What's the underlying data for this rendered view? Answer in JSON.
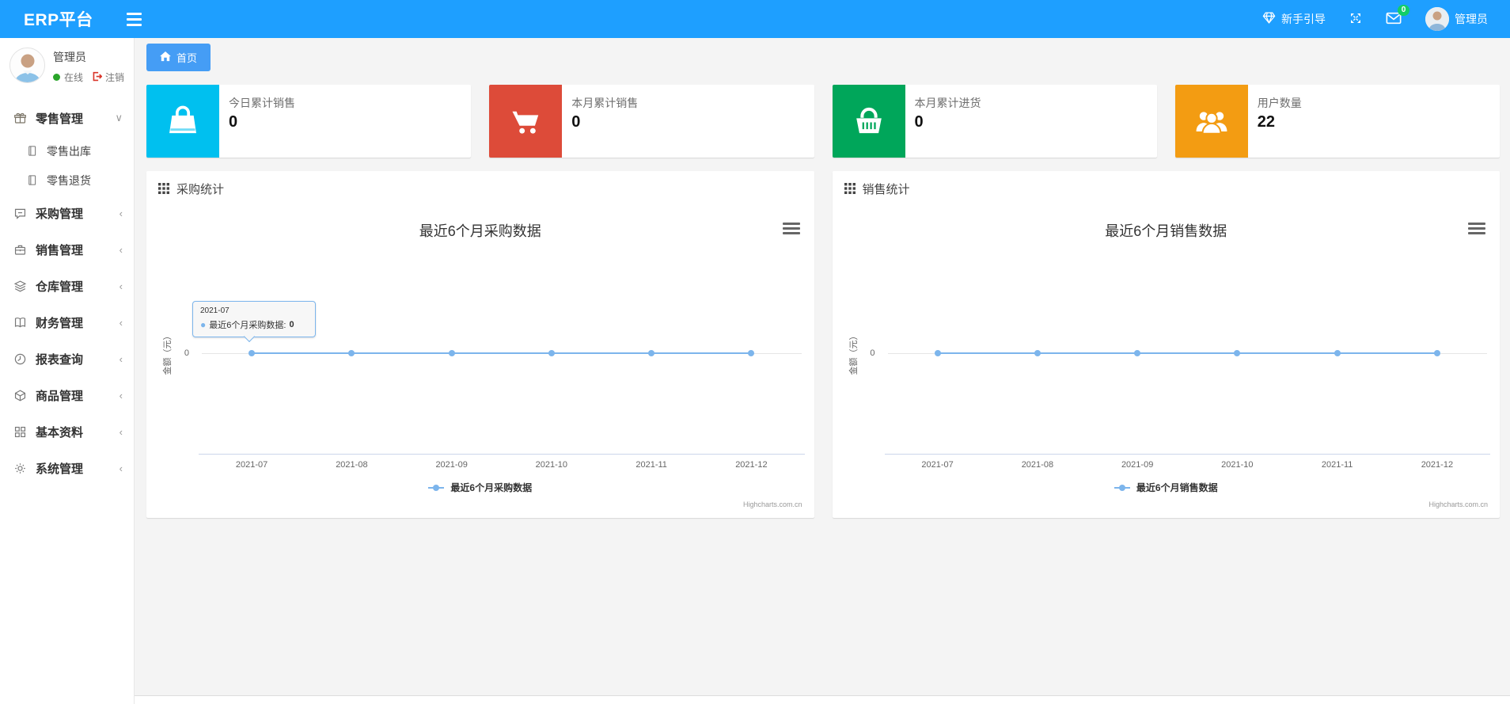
{
  "navbar": {
    "brand": "ERP平台",
    "guide_label": "新手引导",
    "mail_badge": "0",
    "username": "管理员"
  },
  "sidebar": {
    "user": {
      "name": "管理员",
      "status": "在线",
      "logout": "注销"
    },
    "items": [
      {
        "label": "零售管理",
        "expanded": true,
        "children": [
          "零售出库",
          "零售退货"
        ]
      },
      {
        "label": "采购管理"
      },
      {
        "label": "销售管理"
      },
      {
        "label": "仓库管理"
      },
      {
        "label": "财务管理"
      },
      {
        "label": "报表查询"
      },
      {
        "label": "商品管理"
      },
      {
        "label": "基本资料"
      },
      {
        "label": "系统管理"
      }
    ]
  },
  "tabs": {
    "home": "首页"
  },
  "stats": [
    {
      "label": "今日累计销售",
      "value": "0",
      "color": "#00c0ef",
      "icon": "bag-icon"
    },
    {
      "label": "本月累计销售",
      "value": "0",
      "color": "#dd4b39",
      "icon": "cart-icon"
    },
    {
      "label": "本月累计进货",
      "value": "0",
      "color": "#00a65a",
      "icon": "basket-icon"
    },
    {
      "label": "用户数量",
      "value": "22",
      "color": "#f39c12",
      "icon": "users-icon"
    }
  ],
  "panels": [
    {
      "title": "采购统计"
    },
    {
      "title": "销售统计"
    }
  ],
  "colors": {
    "navbar": "#1e9fff",
    "tab": "#459df5",
    "badge": "#13ce66",
    "online": "#2aa52a",
    "logout": "#dd4b39",
    "chart_line": "#7cb5ec"
  },
  "chart_data": [
    {
      "type": "line",
      "title": "最近6个月采购数据",
      "categories": [
        "2021-07",
        "2021-08",
        "2021-09",
        "2021-10",
        "2021-11",
        "2021-12"
      ],
      "series": [
        {
          "name": "最近6个月采购数据",
          "values": [
            0,
            0,
            0,
            0,
            0,
            0
          ]
        }
      ],
      "ylabel": "金额（元）",
      "yticks": [
        "0"
      ],
      "grid": "off",
      "legend_position": "bottom",
      "line_color": "#7cb5ec",
      "credit": "Highcharts.com.cn",
      "tooltip": {
        "header": "2021-07",
        "text": "最近6个月采购数据: ",
        "value": "0"
      }
    },
    {
      "type": "line",
      "title": "最近6个月销售数据",
      "categories": [
        "2021-07",
        "2021-08",
        "2021-09",
        "2021-10",
        "2021-11",
        "2021-12"
      ],
      "series": [
        {
          "name": "最近6个月销售数据",
          "values": [
            0,
            0,
            0,
            0,
            0,
            0
          ]
        }
      ],
      "ylabel": "金额（元）",
      "yticks": [
        "0"
      ],
      "grid": "off",
      "legend_position": "bottom",
      "line_color": "#7cb5ec",
      "credit": "Highcharts.com.cn"
    }
  ]
}
